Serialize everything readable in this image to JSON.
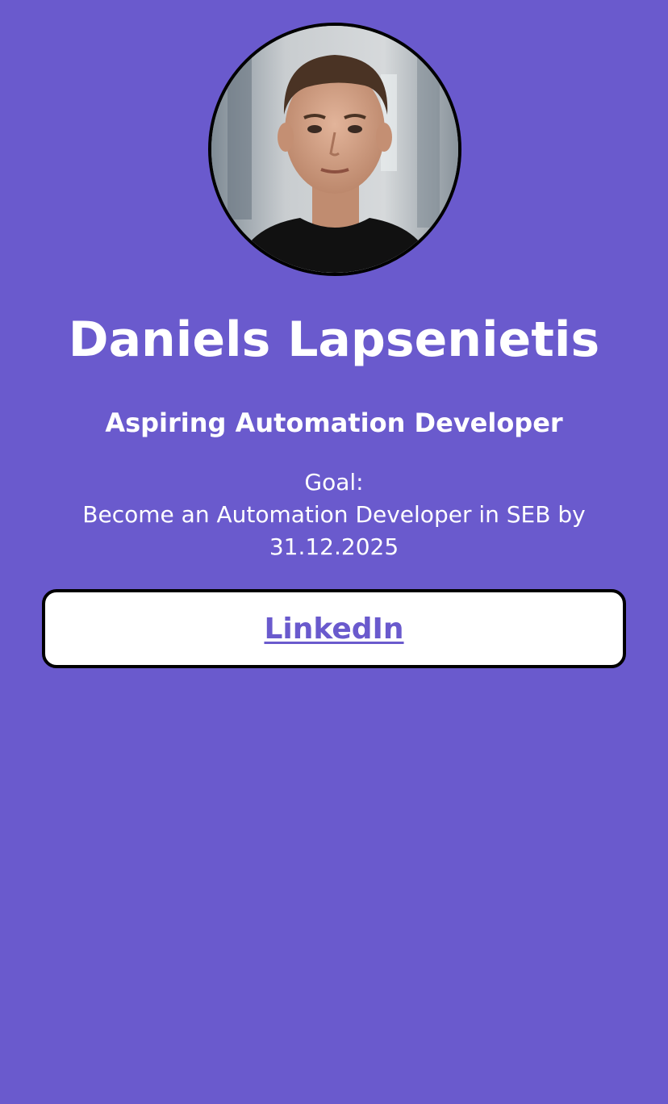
{
  "profile": {
    "name": "Daniels Lapsenietis",
    "headline": "Aspiring Automation Developer",
    "goal_label": "Goal:",
    "goal_line1": "Become an Automation Developer in SEB by",
    "goal_line2": "31.12.2025"
  },
  "links": {
    "linkedin_label": "LinkedIn"
  },
  "colors": {
    "background": "#6a5acd",
    "card": "#ffffff",
    "border": "#000000",
    "link_text": "#6a5acd"
  }
}
